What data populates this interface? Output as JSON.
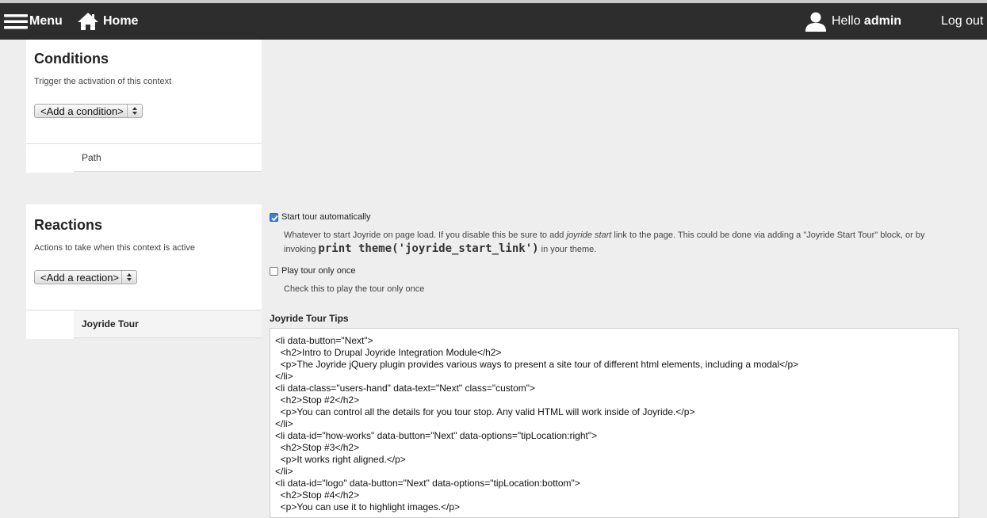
{
  "toolbar": {
    "menu_label": "Menu",
    "home_label": "Home",
    "hello_prefix": "Hello",
    "hello_user": "admin",
    "logout_label": "Log out"
  },
  "conditions": {
    "title": "Conditions",
    "description": "Trigger the activation of this context",
    "select_value": "<Add a condition>",
    "items": [
      {
        "label": "Path"
      }
    ]
  },
  "reactions": {
    "title": "Reactions",
    "description": "Actions to take when this context is active",
    "select_value": "<Add a reaction>",
    "items": [
      {
        "label": "Joyride Tour"
      }
    ]
  },
  "settings": {
    "start_auto": {
      "label": "Start tour automatically",
      "checked": true,
      "help_part1": "Whatever to start Joyride on page load. If you disable this be sure to add ",
      "help_em": "joyride start",
      "help_part2": " link to the page. This could be done via adding a \"Joyride Start Tour\" block, or by",
      "help_part3": "invoking ",
      "help_code": "print theme('joyride_start_link')",
      "help_part4": " in your theme."
    },
    "play_once": {
      "label": "Play tour only once",
      "checked": false,
      "help": "Check this to play the tour only once"
    },
    "tips": {
      "label": "Joyride Tour Tips",
      "lines": [
        "<li data-button=\"Next\">",
        "  <h2>Intro to Drupal Joyride Integration Module</h2>",
        "  <p>The Joyride jQuery plugin provides various ways to present a site tour of different html elements, including a modal</p>",
        "</li>",
        "<li data-class=\"users-hand\" data-text=\"Next\" class=\"custom\">",
        "  <h2>Stop #2</h2>",
        "  <p>You can control all the details for you tour stop. Any valid HTML will work inside of Joyride.</p>",
        "</li>",
        "<li data-id=\"how-works\" data-button=\"Next\" data-options=\"tipLocation:right\">",
        "  <h2>Stop #3</h2>",
        "  <p>It works right aligned.</p>",
        "</li>",
        "<li data-id=\"logo\" data-button=\"Next\" data-options=\"tipLocation:bottom\">",
        "  <h2>Stop #4</h2>",
        "  <p>You can use it to highlight images.</p>"
      ]
    }
  },
  "colors": {
    "toolbar_bg": "#2d2d2d",
    "page_bg": "#eeeeee",
    "checkbox_checked": "#3f7fd5"
  }
}
